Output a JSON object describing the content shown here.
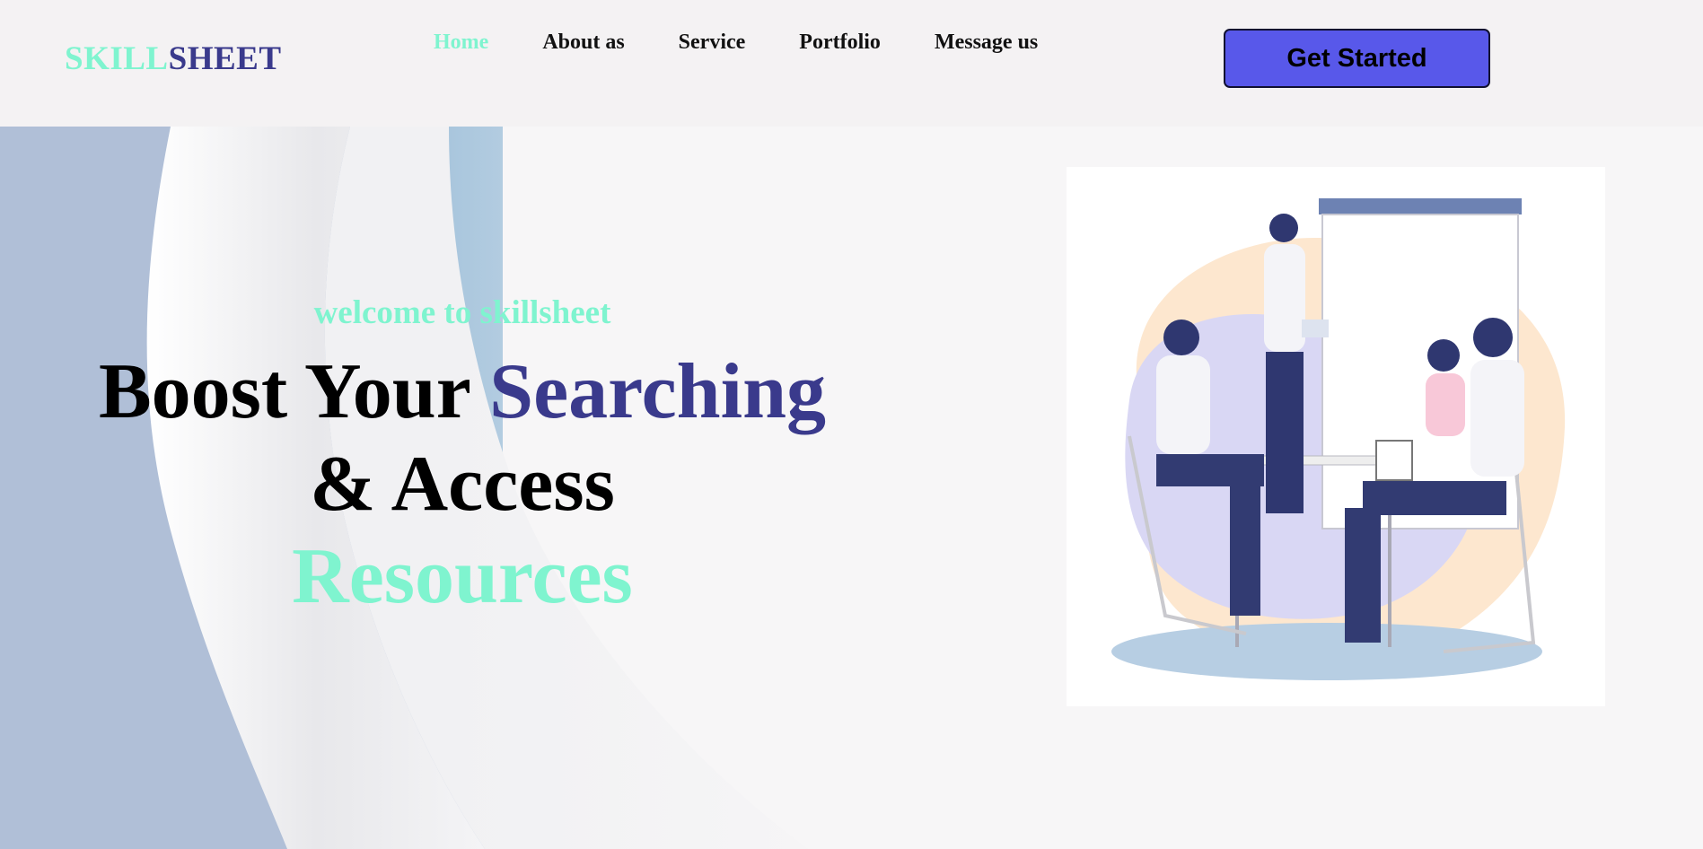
{
  "brand": {
    "part1": "SKILL",
    "part2": "SHEET"
  },
  "nav": {
    "items": [
      {
        "label": "Home",
        "active": true
      },
      {
        "label": "About as",
        "active": false
      },
      {
        "label": "Service",
        "active": false
      },
      {
        "label": "Portfolio",
        "active": false
      },
      {
        "label": "Message us",
        "active": false
      }
    ],
    "cta_label": "Get Started"
  },
  "hero": {
    "welcome": "welcome to skillsheet",
    "line1_a": "Boost Your ",
    "line1_b": "Searching",
    "line2": "& Access",
    "line3": "Resources"
  },
  "colors": {
    "mint": "#7ff4cf",
    "navy": "#3a3a8c",
    "button": "#5858ea"
  },
  "illustration": {
    "icon": "team-meeting-illustration"
  }
}
